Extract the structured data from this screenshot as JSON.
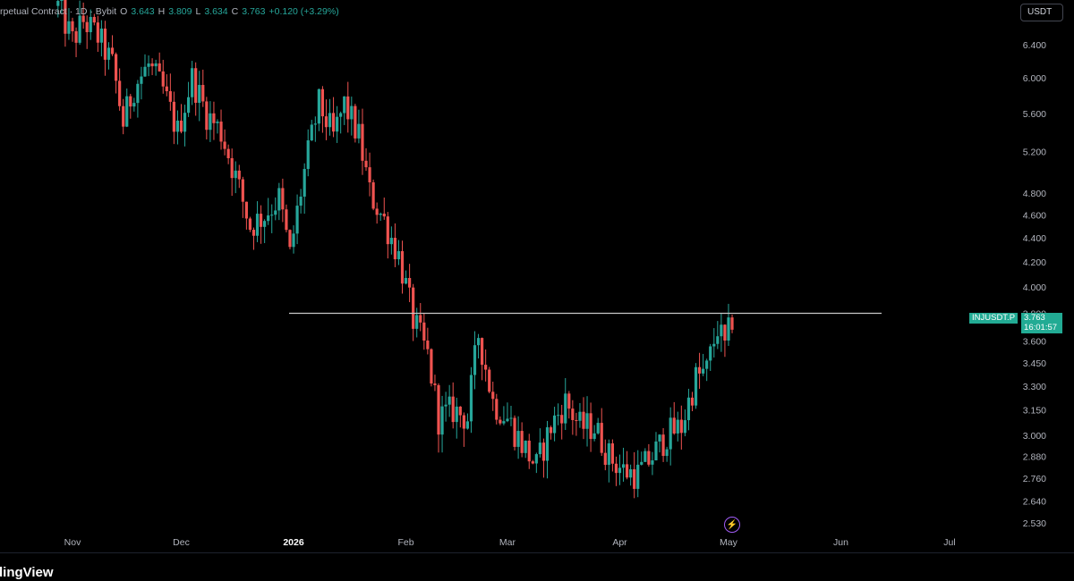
{
  "header": {
    "title": "rpetual Contract · 1D · Bybit",
    "o_label": "O",
    "o_value": "3.643",
    "h_label": "H",
    "h_value": "3.809",
    "l_label": "L",
    "l_value": "3.634",
    "c_label": "C",
    "c_value": "3.763",
    "change": "+0.120 (+3.29%)"
  },
  "currency_button": "USDT",
  "price_tag": {
    "symbol": "INJUSDT.P",
    "price": "3.763",
    "countdown": "16:01:57"
  },
  "brand": "dingView",
  "colors": {
    "up": "#26a69a",
    "down": "#ef5350",
    "background": "#000000",
    "axis_text": "#b2b5be",
    "horizontal_line": "#c8c8c8",
    "price_tag": "#22ab94"
  },
  "chart_data": {
    "type": "candlestick",
    "scale": "log",
    "ylim": [
      2.53,
      6.9
    ],
    "y_ticks": [
      {
        "value": 6.4,
        "label": "6.400"
      },
      {
        "value": 6.0,
        "label": "6.000"
      },
      {
        "value": 5.6,
        "label": "5.600"
      },
      {
        "value": 5.2,
        "label": "5.200"
      },
      {
        "value": 4.8,
        "label": "4.800"
      },
      {
        "value": 4.6,
        "label": "4.600"
      },
      {
        "value": 4.4,
        "label": "4.400"
      },
      {
        "value": 4.2,
        "label": "4.200"
      },
      {
        "value": 4.0,
        "label": "4.000"
      },
      {
        "value": 3.8,
        "label": "3.800"
      },
      {
        "value": 3.6,
        "label": "3.600"
      },
      {
        "value": 3.45,
        "label": "3.450"
      },
      {
        "value": 3.3,
        "label": "3.300"
      },
      {
        "value": 3.15,
        "label": "3.150"
      },
      {
        "value": 3.0,
        "label": "3.000"
      },
      {
        "value": 2.88,
        "label": "2.880"
      },
      {
        "value": 2.76,
        "label": "2.760"
      },
      {
        "value": 2.64,
        "label": "2.640"
      },
      {
        "value": 2.53,
        "label": "2.530"
      }
    ],
    "x_range": [
      "2025-10-24",
      "2026-07-13"
    ],
    "x_ticks": [
      {
        "date": "2025-11-01",
        "label": "Nov",
        "bold": false
      },
      {
        "date": "2025-12-01",
        "label": "Dec",
        "bold": false
      },
      {
        "date": "2026-01-01",
        "label": "2026",
        "bold": true
      },
      {
        "date": "2026-02-01",
        "label": "Feb",
        "bold": false
      },
      {
        "date": "2026-03-01",
        "label": "Mar",
        "bold": false
      },
      {
        "date": "2026-04-01",
        "label": "Apr",
        "bold": false
      },
      {
        "date": "2026-05-01",
        "label": "May",
        "bold": false
      },
      {
        "date": "2026-06-01",
        "label": "Jun",
        "bold": false
      },
      {
        "date": "2026-07-01",
        "label": "Jul",
        "bold": false
      }
    ],
    "horizontal_line": {
      "price": 3.8,
      "from": "2026-01-01",
      "to": "2026-05-15"
    },
    "keypoints": [
      [
        "2025-10-28",
        6.9
      ],
      [
        "2025-11-01",
        6.45
      ],
      [
        "2025-11-04",
        6.7
      ],
      [
        "2025-11-08",
        6.5
      ],
      [
        "2025-11-12",
        6.15
      ],
      [
        "2025-11-15",
        5.5
      ],
      [
        "2025-11-18",
        5.9
      ],
      [
        "2025-11-22",
        6.15
      ],
      [
        "2025-11-26",
        5.85
      ],
      [
        "2025-11-30",
        5.4
      ],
      [
        "2025-12-04",
        6.0
      ],
      [
        "2025-12-08",
        5.6
      ],
      [
        "2025-12-12",
        5.4
      ],
      [
        "2025-12-16",
        4.95
      ],
      [
        "2025-12-20",
        4.5
      ],
      [
        "2025-12-24",
        4.6
      ],
      [
        "2025-12-28",
        4.75
      ],
      [
        "2025-12-31",
        4.25
      ],
      [
        "2026-01-04",
        5.0
      ],
      [
        "2026-01-08",
        5.7
      ],
      [
        "2026-01-12",
        5.35
      ],
      [
        "2026-01-15",
        5.7
      ],
      [
        "2026-01-19",
        5.35
      ],
      [
        "2026-01-22",
        4.8
      ],
      [
        "2026-01-26",
        4.55
      ],
      [
        "2026-01-30",
        4.25
      ],
      [
        "2026-02-03",
        3.75
      ],
      [
        "2026-02-07",
        3.5
      ],
      [
        "2026-02-10",
        3.1
      ],
      [
        "2026-02-14",
        3.15
      ],
      [
        "2026-02-18",
        3.1
      ],
      [
        "2026-02-21",
        3.65
      ],
      [
        "2026-02-25",
        3.2
      ],
      [
        "2026-03-01",
        3.1
      ],
      [
        "2026-03-05",
        2.95
      ],
      [
        "2026-03-09",
        2.82
      ],
      [
        "2026-03-13",
        3.05
      ],
      [
        "2026-03-17",
        3.2
      ],
      [
        "2026-03-21",
        3.05
      ],
      [
        "2026-03-25",
        3.05
      ],
      [
        "2026-03-29",
        2.88
      ],
      [
        "2026-04-02",
        2.8
      ],
      [
        "2026-04-06",
        2.78
      ],
      [
        "2026-04-10",
        2.88
      ],
      [
        "2026-04-14",
        3.0
      ],
      [
        "2026-04-18",
        3.05
      ],
      [
        "2026-04-22",
        3.35
      ],
      [
        "2026-04-25",
        3.4
      ],
      [
        "2026-04-28",
        3.7
      ],
      [
        "2026-04-30",
        3.55
      ],
      [
        "2026-05-02",
        3.76
      ]
    ]
  }
}
